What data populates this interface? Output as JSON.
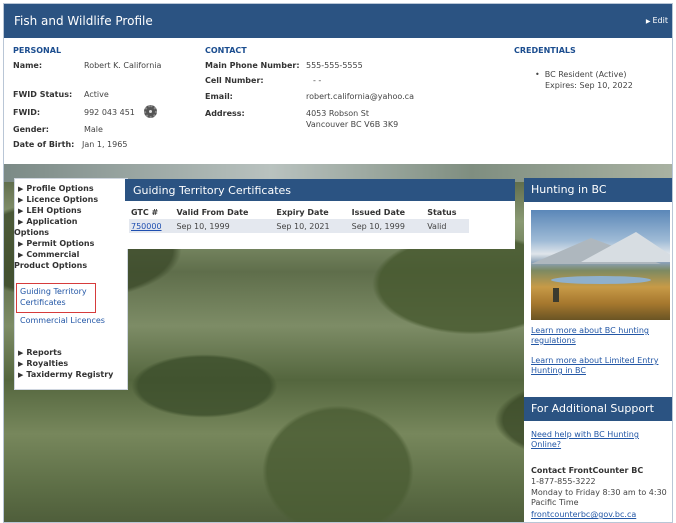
{
  "header": {
    "title": "Fish and Wildlife Profile",
    "edit_label": "Edit"
  },
  "personal": {
    "heading": "PERSONAL",
    "name_label": "Name:",
    "name": "Robert K. California",
    "fwid_status_label": "FWID Status:",
    "fwid_status": "Active",
    "fwid_label": "FWID:",
    "fwid": "992 043 451",
    "gender_label": "Gender:",
    "gender": "Male",
    "dob_label": "Date of Birth:",
    "dob": "Jan 1, 1965"
  },
  "contact": {
    "heading": "CONTACT",
    "main_phone_label": "Main Phone Number:",
    "main_phone": "555-555-5555",
    "cell_label": "Cell Number:",
    "cell": "- -",
    "email_label": "Email:",
    "email": "robert.california@yahoo.ca",
    "address_label": "Address:",
    "address_line1": "4053 Robson St",
    "address_line2": "Vancouver BC V6B 3K9"
  },
  "credentials": {
    "heading": "CREDENTIALS",
    "items": [
      {
        "line1": "BC Resident (Active)",
        "line2": "Expires: Sep 10, 2022"
      }
    ]
  },
  "leftnav": {
    "items": [
      "Profile Options",
      "Licence Options",
      "LEH Options",
      "Application",
      "Options",
      "Permit Options",
      "Commercial",
      "Product Options"
    ],
    "links": [
      "Guiding Territory",
      "Certificates",
      "Commercial Licences"
    ],
    "bottom_items": [
      "Reports",
      "Royalties",
      "Taxidermy Registry"
    ]
  },
  "gtc": {
    "title": "Guiding Territory Certificates",
    "columns": [
      "GTC #",
      "Valid From Date",
      "Expiry Date",
      "Issued Date",
      "Status"
    ],
    "rows": [
      [
        "750000",
        "Sep 10, 1999",
        "Sep 10, 2021",
        "Sep 10, 1999",
        "Valid"
      ]
    ]
  },
  "hunting": {
    "title": "Hunting in BC",
    "link1_line1": "Learn more about BC hunting",
    "link1_line2": "regulations",
    "link2_line1": "Learn more about Limited Entry",
    "link2_line2": "Hunting in BC"
  },
  "support": {
    "title": "For Additional Support",
    "help_line1": "Need help with BC Hunting",
    "help_line2": "Online?",
    "contact_title": "Contact FrontCounter BC",
    "phone": "1-877-855-3222",
    "hours_line1": "Monday to Friday 8:30 am to 4:30",
    "hours_line2": "Pacific Time",
    "email": "frontcounterbc@gov.bc.ca"
  },
  "colors": {
    "header_blue": "#2b5382",
    "link_blue": "#2357a6",
    "section_blue": "#1b4d8f",
    "selected_border": "#d63b3b"
  }
}
